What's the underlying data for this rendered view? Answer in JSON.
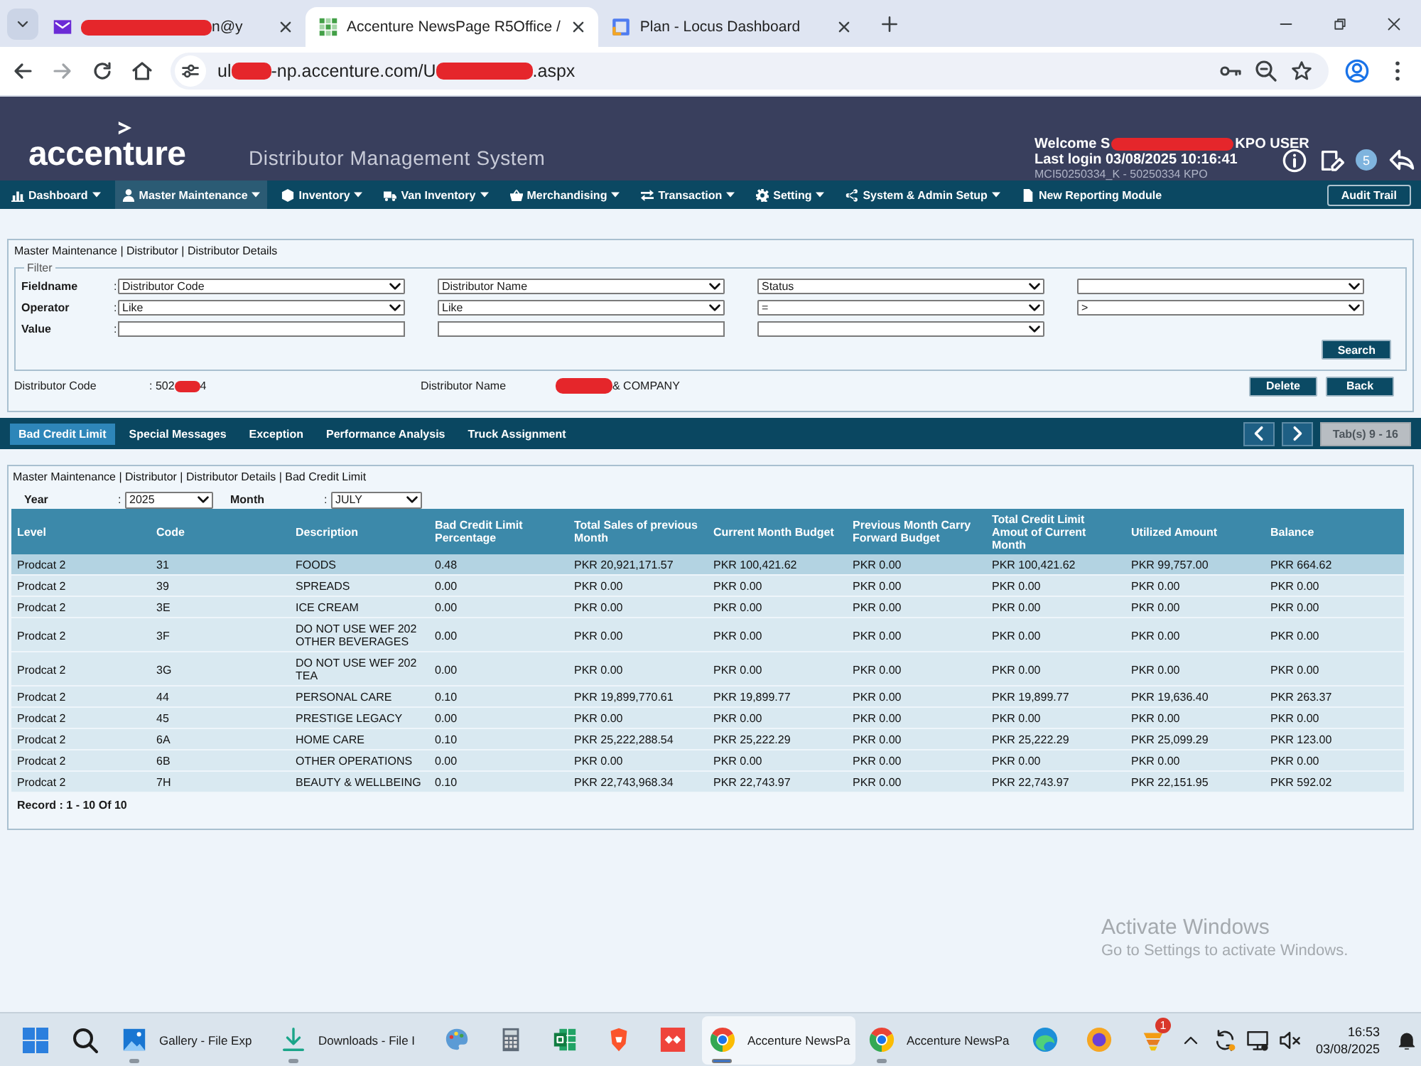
{
  "browser": {
    "tabs": [
      {
        "title": [
          {
            "kind": "redaction"
          },
          {
            "kind": "text",
            "text": "n@y"
          }
        ],
        "selected": false
      },
      {
        "title": [
          {
            "kind": "text",
            "text": "Accenture NewsPage R5Office /"
          }
        ],
        "selected": true
      },
      {
        "title": [
          {
            "kind": "text",
            "text": "Plan - Locus Dashboard"
          }
        ],
        "selected": false
      }
    ],
    "address": [
      {
        "kind": "text",
        "text": "ul"
      },
      {
        "kind": "redaction"
      },
      {
        "kind": "text",
        "text": "-np.accenture.com/U"
      },
      {
        "kind": "redaction"
      },
      {
        "kind": "text",
        "text": ".aspx"
      }
    ]
  },
  "app": {
    "logo": "accenture",
    "title": "Distributor Management System",
    "welcome": [
      {
        "kind": "text",
        "text": "Welcome S"
      },
      {
        "kind": "redaction"
      },
      {
        "kind": "text",
        "text": "KPO USER"
      }
    ],
    "last_login": "Last login 03/08/2025 10:16:41",
    "account": "MCI50250334_K - 50250334 KPO",
    "notifications": "5"
  },
  "nav": {
    "items": [
      {
        "label": "Dashboard",
        "dropdown": true,
        "selected": false
      },
      {
        "label": "Master Maintenance",
        "dropdown": true,
        "selected": true
      },
      {
        "label": "Inventory",
        "dropdown": true,
        "selected": false
      },
      {
        "label": "Van Inventory",
        "dropdown": true,
        "selected": false
      },
      {
        "label": "Merchandising",
        "dropdown": true,
        "selected": false
      },
      {
        "label": "Transaction",
        "dropdown": true,
        "selected": false
      },
      {
        "label": "Setting",
        "dropdown": true,
        "selected": false
      },
      {
        "label": "System & Admin Setup",
        "dropdown": true,
        "selected": false
      },
      {
        "label": "New Reporting Module",
        "dropdown": false,
        "selected": false
      }
    ],
    "audit_button": "Audit Trail"
  },
  "details": {
    "breadcrumb": "Master Maintenance | Distributor | Distributor Details",
    "filter": {
      "legend": "Filter",
      "rows": [
        {
          "label": "Fieldname",
          "colon": ":",
          "controls": [
            {
              "kind": "select",
              "value": "Distributor Code"
            },
            {
              "kind": "select",
              "value": "Distributor Name"
            },
            {
              "kind": "select",
              "value": "Status"
            },
            {
              "kind": "select"
            }
          ]
        },
        {
          "label": "Operator",
          "colon": ":",
          "controls": [
            {
              "kind": "select",
              "value": "Like"
            },
            {
              "kind": "select",
              "value": "Like"
            },
            {
              "kind": "select",
              "value": "="
            },
            {
              "kind": "select",
              "value": ">"
            }
          ]
        },
        {
          "label": "Value",
          "colon": ":",
          "controls": [
            {
              "kind": "input"
            },
            {
              "kind": "input"
            },
            {
              "kind": "select"
            }
          ]
        }
      ],
      "search_button": "Search"
    },
    "fields": [
      {
        "label": "Distributor Code",
        "value": [
          {
            "kind": "text",
            "text": ": 502"
          },
          {
            "kind": "redaction"
          },
          {
            "kind": "text",
            "text": "4"
          }
        ]
      },
      {
        "label": "Distributor Name",
        "value": [
          {
            "kind": "redaction"
          },
          {
            "kind": "text",
            "text": "& COMPANY"
          }
        ]
      }
    ],
    "buttons": [
      "Delete",
      "Back"
    ]
  },
  "subtabs": {
    "items": [
      {
        "label": "Bad Credit Limit",
        "selected": true
      },
      {
        "label": "Special Messages",
        "selected": false
      },
      {
        "label": "Exception",
        "selected": false
      },
      {
        "label": "Performance Analysis",
        "selected": false
      },
      {
        "label": "Truck Assignment",
        "selected": false
      }
    ],
    "pager": {
      "label": "Tab(s) 9 - 16",
      "disabled": true
    }
  },
  "credit": {
    "breadcrumb": "Master Maintenance | Distributor | Distributor Details | Bad Credit Limit",
    "year": {
      "label": "Year",
      "colon": ":",
      "value": "2025"
    },
    "month": {
      "label": "Month",
      "colon": ":",
      "value": "JULY"
    },
    "table": {
      "columns": [
        "Level",
        "Code",
        "Description",
        "Bad Credit Limit Percentage",
        "Total Sales of previous Month",
        "Current Month Budget",
        "Previous Month Carry Forward Budget",
        "Total Credit Limit Amout of Current Month",
        "Utilized Amount",
        "Balance"
      ],
      "rows": [
        {
          "selected": true,
          "cells": [
            "Prodcat 2",
            "31",
            "FOODS",
            "0.48",
            "PKR 20,921,171.57",
            "PKR 100,421.62",
            "PKR 0.00",
            "PKR 100,421.62",
            "PKR 99,757.00",
            "PKR 664.62"
          ]
        },
        {
          "selected": false,
          "cells": [
            "Prodcat 2",
            "39",
            "SPREADS",
            "0.00",
            "PKR 0.00",
            "PKR 0.00",
            "PKR 0.00",
            "PKR 0.00",
            "PKR 0.00",
            "PKR 0.00"
          ]
        },
        {
          "selected": false,
          "cells": [
            "Prodcat 2",
            "3E",
            "ICE CREAM",
            "0.00",
            "PKR 0.00",
            "PKR 0.00",
            "PKR 0.00",
            "PKR 0.00",
            "PKR 0.00",
            "PKR 0.00"
          ]
        },
        {
          "selected": false,
          "cells": [
            "Prodcat 2",
            "3F",
            "DO NOT USE WEF 202 OTHER BEVERAGES",
            "0.00",
            "PKR 0.00",
            "PKR 0.00",
            "PKR 0.00",
            "PKR 0.00",
            "PKR 0.00",
            "PKR 0.00"
          ]
        },
        {
          "selected": false,
          "cells": [
            "Prodcat 2",
            "3G",
            "DO NOT USE WEF 202 TEA",
            "0.00",
            "PKR 0.00",
            "PKR 0.00",
            "PKR 0.00",
            "PKR 0.00",
            "PKR 0.00",
            "PKR 0.00"
          ]
        },
        {
          "selected": false,
          "cells": [
            "Prodcat 2",
            "44",
            "PERSONAL CARE",
            "0.10",
            "PKR 19,899,770.61",
            "PKR 19,899.77",
            "PKR 0.00",
            "PKR 19,899.77",
            "PKR 19,636.40",
            "PKR 263.37"
          ]
        },
        {
          "selected": false,
          "cells": [
            "Prodcat 2",
            "45",
            "PRESTIGE LEGACY",
            "0.00",
            "PKR 0.00",
            "PKR 0.00",
            "PKR 0.00",
            "PKR 0.00",
            "PKR 0.00",
            "PKR 0.00"
          ]
        },
        {
          "selected": false,
          "cells": [
            "Prodcat 2",
            "6A",
            "HOME CARE",
            "0.10",
            "PKR 25,222,288.54",
            "PKR 25,222.29",
            "PKR 0.00",
            "PKR 25,222.29",
            "PKR 25,099.29",
            "PKR 123.00"
          ]
        },
        {
          "selected": false,
          "cells": [
            "Prodcat 2",
            "6B",
            "OTHER OPERATIONS",
            "0.00",
            "PKR 0.00",
            "PKR 0.00",
            "PKR 0.00",
            "PKR 0.00",
            "PKR 0.00",
            "PKR 0.00"
          ]
        },
        {
          "selected": false,
          "cells": [
            "Prodcat 2",
            "7H",
            "BEAUTY & WELLBEING",
            "0.10",
            "PKR 22,743,968.34",
            "PKR 22,743.97",
            "PKR 0.00",
            "PKR 22,743.97",
            "PKR 22,151.95",
            "PKR 592.02"
          ]
        }
      ]
    },
    "record": "Record : 1 - 10 Of 10"
  },
  "activation_notice": {
    "title": "Activate Windows",
    "text": "Go to Settings to activate Windows."
  },
  "taskbar": {
    "apps": [
      {
        "label": "Gallery - File Exp",
        "open": true,
        "selected": false
      },
      {
        "label": "Downloads - File I",
        "open": true,
        "selected": false
      },
      {
        "open": false,
        "selected": false
      },
      {
        "open": false,
        "selected": false
      },
      {
        "open": false,
        "selected": false
      },
      {
        "open": false,
        "selected": false
      },
      {
        "open": false,
        "selected": false
      },
      {
        "label": "Accenture NewsPa",
        "open": true,
        "selected": true
      },
      {
        "label": "Accenture NewsPa",
        "open": true,
        "selected": false
      },
      {
        "open": false,
        "selected": false
      },
      {
        "open": false,
        "selected": false
      },
      {
        "open": false,
        "selected": false,
        "badge": "1"
      }
    ],
    "time": "16:53",
    "date": "03/08/2025"
  }
}
